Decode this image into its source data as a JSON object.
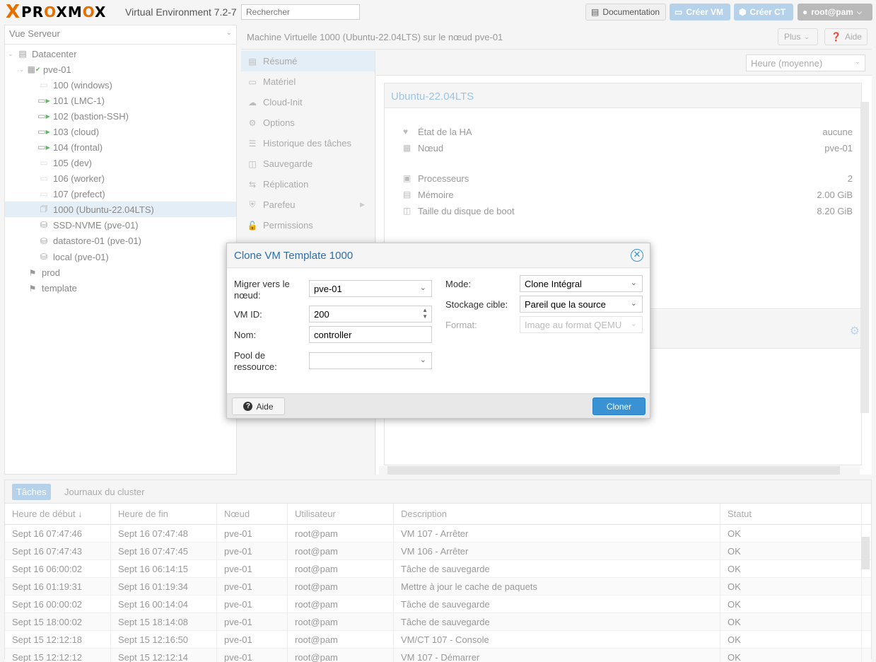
{
  "header": {
    "logo_x": "X",
    "logo_word_pre": "PR",
    "logo_word_o": "O",
    "logo_word_mid": "XM",
    "logo_word_o2": "O",
    "logo_word_end": "X",
    "version": "Virtual Environment 7.2-7",
    "search_placeholder": "Rechercher",
    "documentation": "Documentation",
    "create_vm": "Créer VM",
    "create_ct": "Créer CT",
    "user": "root@pam"
  },
  "tree": {
    "view": "Vue Serveur",
    "nodes": [
      {
        "label": "Datacenter",
        "icon": "datacenter-icon"
      },
      {
        "label": "pve-01",
        "icon": "node-online-icon"
      },
      {
        "label": "100 (windows)",
        "icon": "vm-stopped-icon"
      },
      {
        "label": "101 (LMC-1)",
        "icon": "vm-running-icon"
      },
      {
        "label": "102 (bastion-SSH)",
        "icon": "vm-running-icon"
      },
      {
        "label": "103 (cloud)",
        "icon": "vm-running-icon"
      },
      {
        "label": "104 (frontal)",
        "icon": "vm-running-icon"
      },
      {
        "label": "105 (dev)",
        "icon": "vm-stopped-icon"
      },
      {
        "label": "106 (worker)",
        "icon": "vm-stopped-icon"
      },
      {
        "label": "107 (prefect)",
        "icon": "vm-stopped-icon"
      },
      {
        "label": "1000 (Ubuntu-22.04LTS)",
        "icon": "template-icon"
      },
      {
        "label": "SSD-NVME (pve-01)",
        "icon": "storage-icon"
      },
      {
        "label": "datastore-01 (pve-01)",
        "icon": "storage-icon"
      },
      {
        "label": "local (pve-01)",
        "icon": "storage-icon"
      },
      {
        "label": "prod",
        "icon": "tag-icon"
      },
      {
        "label": "template",
        "icon": "tag-icon"
      }
    ]
  },
  "content": {
    "title": "Machine Virtuelle 1000 (Ubuntu-22.04LTS) sur le nœud pve-01",
    "more": "Plus",
    "help": "Aide",
    "nav": [
      {
        "label": "Résumé"
      },
      {
        "label": "Matériel"
      },
      {
        "label": "Cloud-Init"
      },
      {
        "label": "Options"
      },
      {
        "label": "Historique des tâches"
      },
      {
        "label": "Sauvegarde"
      },
      {
        "label": "Réplication"
      },
      {
        "label": "Parefeu"
      },
      {
        "label": "Permissions"
      }
    ],
    "timeframe": "Heure (moyenne)",
    "status": {
      "name": "Ubuntu-22.04LTS",
      "ha_label": "État de la HA",
      "ha_value": "aucune",
      "node_label": "Nœud",
      "node_value": "pve-01",
      "cpu_label": "Processeurs",
      "cpu_value": "2",
      "mem_label": "Mémoire",
      "mem_value": "2.00 GiB",
      "disk_label": "Taille du disque de boot",
      "disk_value": "8.20 GiB"
    }
  },
  "tasks": {
    "tab_tasks": "Tâches",
    "tab_logs": "Journaux du cluster",
    "columns": [
      "Heure de début ↓",
      "Heure de fin",
      "Nœud",
      "Utilisateur",
      "Description",
      "Statut"
    ],
    "rows": [
      [
        "Sept 16 07:47:46",
        "Sept 16 07:47:48",
        "pve-01",
        "root@pam",
        "VM 107 - Arrêter",
        "OK"
      ],
      [
        "Sept 16 07:47:43",
        "Sept 16 07:47:45",
        "pve-01",
        "root@pam",
        "VM 106 - Arrêter",
        "OK"
      ],
      [
        "Sept 16 06:00:02",
        "Sept 16 06:14:15",
        "pve-01",
        "root@pam",
        "Tâche de sauvegarde",
        "OK"
      ],
      [
        "Sept 16 01:19:31",
        "Sept 16 01:19:34",
        "pve-01",
        "root@pam",
        "Mettre à jour le cache de paquets",
        "OK"
      ],
      [
        "Sept 16 00:00:02",
        "Sept 16 00:14:04",
        "pve-01",
        "root@pam",
        "Tâche de sauvegarde",
        "OK"
      ],
      [
        "Sept 15 18:00:02",
        "Sept 15 18:14:08",
        "pve-01",
        "root@pam",
        "Tâche de sauvegarde",
        "OK"
      ],
      [
        "Sept 15 12:12:18",
        "Sept 15 12:16:50",
        "pve-01",
        "root@pam",
        "VM/CT 107 - Console",
        "OK"
      ],
      [
        "Sept 15 12:12:12",
        "Sept 15 12:12:14",
        "pve-01",
        "root@pam",
        "VM 107 - Démarrer",
        "OK"
      ]
    ]
  },
  "dialog": {
    "title": "Clone VM Template 1000",
    "target_node_label": "Migrer vers le nœud:",
    "target_node_value": "pve-01",
    "vmid_label": "VM ID:",
    "vmid_value": "200",
    "name_label": "Nom:",
    "name_value": "controller",
    "pool_label": "Pool de ressource:",
    "pool_value": "",
    "mode_label": "Mode:",
    "mode_value": "Clone Intégral",
    "storage_label": "Stockage cible:",
    "storage_value": "Pareil que la source",
    "format_label": "Format:",
    "format_value": "Image au format QEMU",
    "help_button": "Aide",
    "clone_button": "Cloner"
  },
  "colors": {
    "accent": "#3892d3",
    "brand_orange": "#e57000",
    "selection": "#e4eef7"
  }
}
